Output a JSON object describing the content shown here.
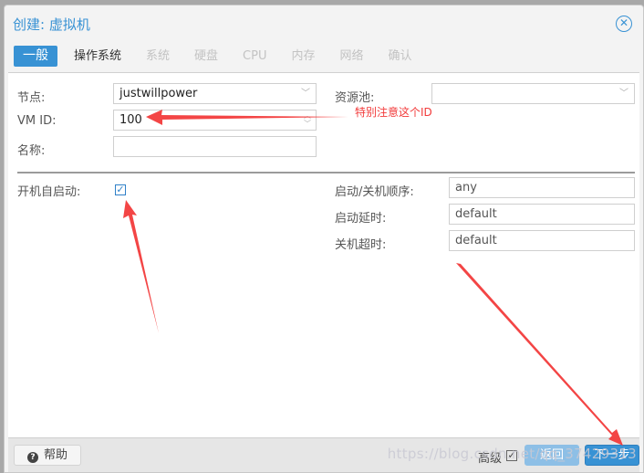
{
  "window": {
    "title": "创建: 虚拟机",
    "close_icon": "close-circle-icon"
  },
  "tabs": [
    {
      "label": "一般",
      "state": "active"
    },
    {
      "label": "操作系统",
      "state": "enabled"
    },
    {
      "label": "系统",
      "state": "disabled"
    },
    {
      "label": "硬盘",
      "state": "disabled"
    },
    {
      "label": "CPU",
      "state": "disabled"
    },
    {
      "label": "内存",
      "state": "disabled"
    },
    {
      "label": "网络",
      "state": "disabled"
    },
    {
      "label": "确认",
      "state": "disabled"
    }
  ],
  "form": {
    "node": {
      "label": "节点:",
      "value": "justwillpower"
    },
    "vmid": {
      "label": "VM ID:",
      "value": "100"
    },
    "name": {
      "label": "名称:",
      "value": ""
    },
    "pool": {
      "label": "资源池:",
      "value": ""
    },
    "onboot": {
      "label": "开机自启动:",
      "checked": true
    },
    "order": {
      "label": "启动/关机顺序:",
      "value": "any"
    },
    "startup_delay": {
      "label": "启动延时:",
      "value": "default"
    },
    "shutdown_timeout": {
      "label": "关机超时:",
      "value": "default"
    }
  },
  "annotation": {
    "text": "特别注意这个ID",
    "color": "#f23b3b"
  },
  "footer": {
    "help_label": "帮助",
    "advanced_label": "高级",
    "advanced_checked": true,
    "back_label": "返回",
    "next_label": "下一步"
  },
  "watermark": "https://blog.csdn.net/qq_37429313",
  "colors": {
    "accent": "#3892d4",
    "annotation": "#f23b3b"
  }
}
